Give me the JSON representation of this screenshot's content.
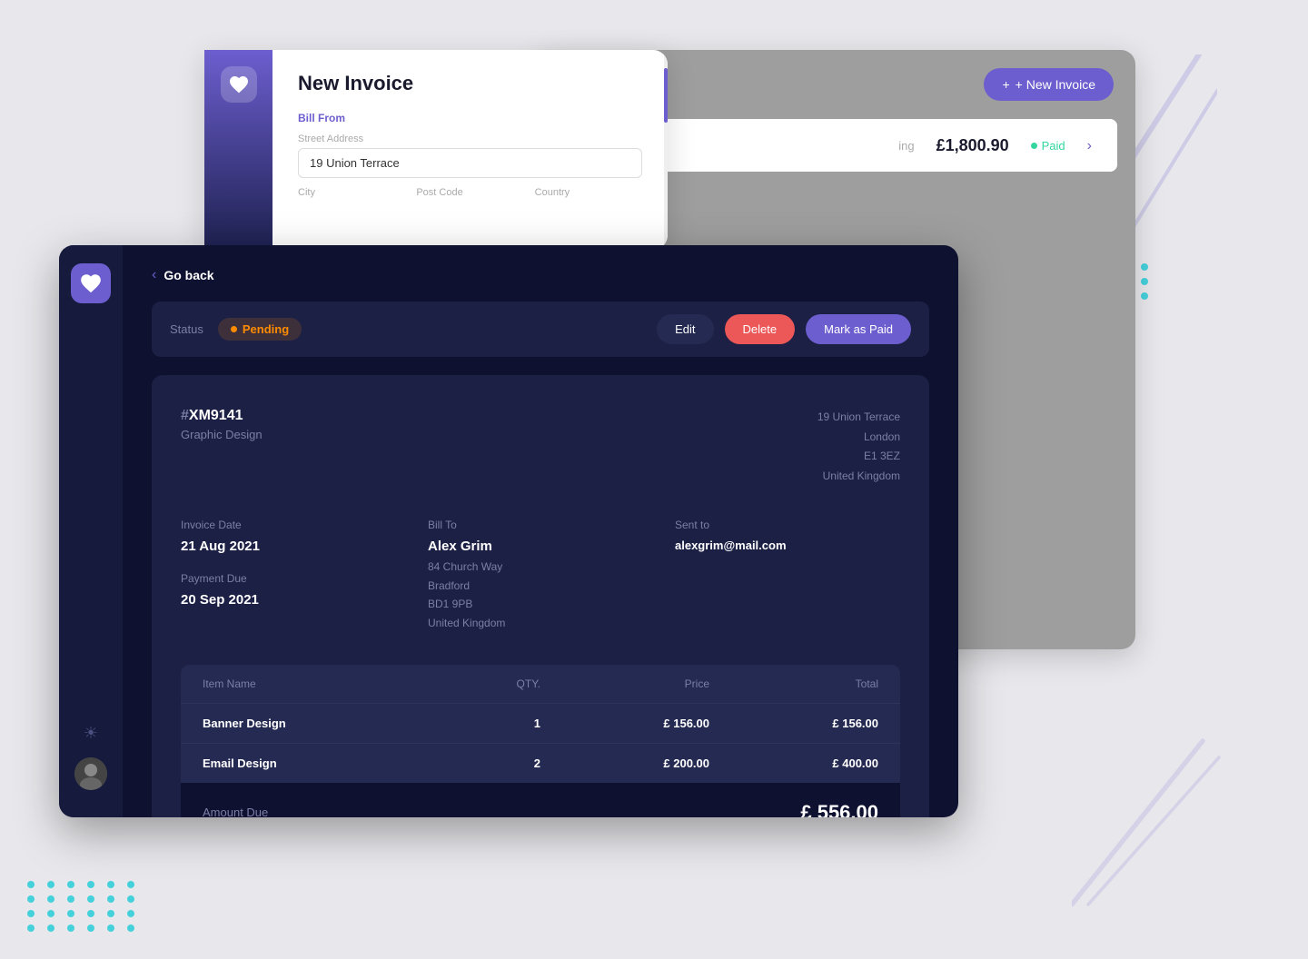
{
  "background": {
    "color": "#e8e8ec"
  },
  "bg_window": {
    "new_invoice_btn": "+ New Invoice",
    "invoice_row": {
      "amount": "£1,800.90",
      "status": "Paid"
    }
  },
  "new_invoice_modal": {
    "title": "New Invoice",
    "bill_from_label": "Bill From",
    "street_address_label": "Street Address",
    "street_address_value": "19 Union Terrace",
    "city_label": "City",
    "postcode_label": "Post Code",
    "country_label": "Country"
  },
  "main_window": {
    "logo_icon": "♡",
    "go_back": "Go back",
    "status_label": "Status",
    "status_value": "Pending",
    "edit_btn": "Edit",
    "delete_btn": "Delete",
    "mark_paid_btn": "Mark as Paid",
    "invoice": {
      "id": "#XM9141",
      "type": "Graphic Design",
      "address_line1": "19 Union Terrace",
      "address_line2": "London",
      "address_line3": "E1 3EZ",
      "address_line4": "United Kingdom",
      "invoice_date_label": "Invoice Date",
      "invoice_date_value": "21 Aug 2021",
      "payment_due_label": "Payment Due",
      "payment_due_value": "20 Sep 2021",
      "bill_to_label": "Bill To",
      "bill_to_name": "Alex Grim",
      "bill_to_address1": "84 Church Way",
      "bill_to_address2": "Bradford",
      "bill_to_address3": "BD1 9PB",
      "bill_to_address4": "United Kingdom",
      "sent_to_label": "Sent to",
      "sent_to_email": "alexgrim@mail.com",
      "col_item_name": "Item Name",
      "col_qty": "QTY.",
      "col_price": "Price",
      "col_total": "Total",
      "items": [
        {
          "name": "Banner Design",
          "qty": "1",
          "price": "£ 156.00",
          "total": "£ 156.00"
        },
        {
          "name": "Email Design",
          "qty": "2",
          "price": "£ 200.00",
          "total": "£ 400.00"
        }
      ],
      "amount_due_label": "Amount Due",
      "amount_due_value": "£ 556.00"
    }
  }
}
